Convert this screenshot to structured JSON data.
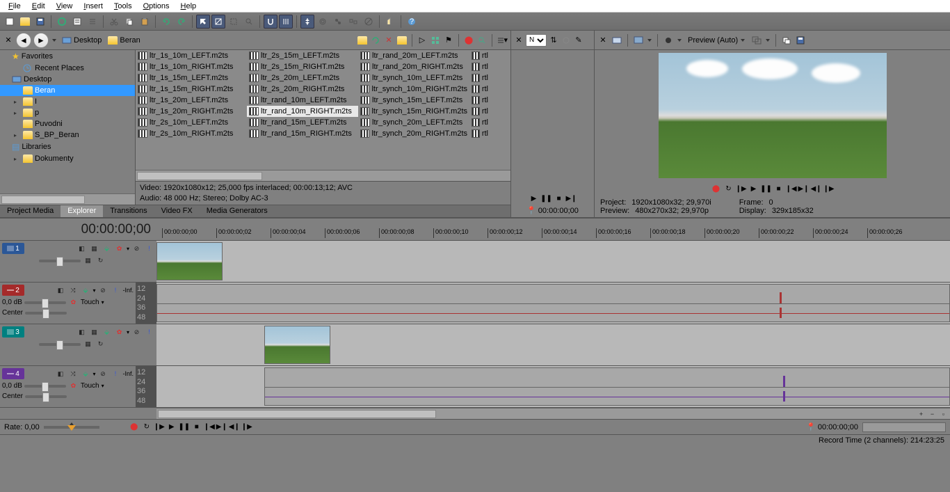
{
  "menu": [
    "File",
    "Edit",
    "View",
    "Insert",
    "Tools",
    "Options",
    "Help"
  ],
  "breadcrumb": {
    "root": "Desktop",
    "current": "Beran"
  },
  "tree": [
    {
      "type": "fav",
      "label": "Favorites",
      "depth": 0,
      "icon": "star"
    },
    {
      "type": "fav",
      "label": "Recent Places",
      "depth": 1,
      "icon": "recent"
    },
    {
      "type": "node",
      "label": "Desktop",
      "depth": 0,
      "icon": "desktop"
    },
    {
      "type": "folder",
      "label": "Beran",
      "depth": 1,
      "selected": true
    },
    {
      "type": "folder",
      "label": "I",
      "depth": 1,
      "expander": true
    },
    {
      "type": "folder",
      "label": "p",
      "depth": 1,
      "expander": true
    },
    {
      "type": "folder",
      "label": "Puvodni",
      "depth": 1
    },
    {
      "type": "folder",
      "label": "S_BP_Beran",
      "depth": 1,
      "expander": true
    },
    {
      "type": "lib",
      "label": "Libraries",
      "depth": 0,
      "icon": "lib"
    },
    {
      "type": "folder",
      "label": "Dokumenty",
      "depth": 1,
      "expander": true
    }
  ],
  "files": {
    "cols": [
      [
        "ltr_1s_10m_LEFT.m2ts",
        "ltr_1s_10m_RIGHT.m2ts",
        "ltr_1s_15m_LEFT.m2ts",
        "ltr_1s_15m_RIGHT.m2ts",
        "ltr_1s_20m_LEFT.m2ts",
        "ltr_1s_20m_RIGHT.m2ts",
        "ltr_2s_10m_LEFT.m2ts",
        "ltr_2s_10m_RIGHT.m2ts"
      ],
      [
        "ltr_2s_15m_LEFT.m2ts",
        "ltr_2s_15m_RIGHT.m2ts",
        "ltr_2s_20m_LEFT.m2ts",
        "ltr_2s_20m_RIGHT.m2ts",
        "ltr_rand_10m_LEFT.m2ts",
        "ltr_rand_10m_RIGHT.m2ts",
        "ltr_rand_15m_LEFT.m2ts",
        "ltr_rand_15m_RIGHT.m2ts"
      ],
      [
        "ltr_rand_20m_LEFT.m2ts",
        "ltr_rand_20m_RIGHT.m2ts",
        "ltr_synch_10m_LEFT.m2ts",
        "ltr_synch_10m_RIGHT.m2ts",
        "ltr_synch_15m_LEFT.m2ts",
        "ltr_synch_15m_RIGHT.m2ts",
        "ltr_synch_20m_LEFT.m2ts",
        "ltr_synch_20m_RIGHT.m2ts"
      ],
      [
        "rtl",
        "rtl",
        "rtl",
        "rtl",
        "rtl",
        "rtl",
        "rtl",
        "rtl"
      ]
    ],
    "selected": "ltr_rand_10m_RIGHT.m2ts",
    "status_line1": "Video: 1920x1080x12; 25,000 fps interlaced; 00:00:13;12; AVC",
    "status_line2": "Audio: 48 000 Hz; Stereo; Dolby AC-3"
  },
  "tabs": [
    "Project Media",
    "Explorer",
    "Transitions",
    "Video FX",
    "Media Generators"
  ],
  "active_tab": "Explorer",
  "trimmer": {
    "dropdown": "N",
    "timecode": "00:00:00;00"
  },
  "preview": {
    "quality": "Preview (Auto)",
    "project_label": "Project:",
    "project_val": "1920x1080x32; 29,970i",
    "preview_label": "Preview:",
    "preview_val": "480x270x32; 29,970p",
    "frame_label": "Frame:",
    "frame_val": "0",
    "display_label": "Display:",
    "display_val": "329x185x32"
  },
  "timecode": "00:00:00;00",
  "ruler_ticks": [
    "00:00:00;00",
    "00:00:00;02",
    "00:00:00;04",
    "00:00:00;06",
    "00:00:00;08",
    "00:00:00;10",
    "00:00:00;12",
    "00:00:00;14",
    "00:00:00;16",
    "00:00:00;18",
    "00:00:00;20",
    "00:00:00;22",
    "00:00:00;24",
    "00:00:00;26"
  ],
  "tracks": [
    {
      "num": "1",
      "color": "tn-blue",
      "type": "video"
    },
    {
      "num": "2",
      "color": "tn-red",
      "type": "audio",
      "vol": "0,0 dB",
      "pan": "Center",
      "mode": "Touch",
      "inf": "-Inf.",
      "meters": [
        "12",
        "24",
        "36",
        "48"
      ]
    },
    {
      "num": "3",
      "color": "tn-teal",
      "type": "video"
    },
    {
      "num": "4",
      "color": "tn-purple",
      "type": "audio",
      "vol": "0,0 dB",
      "pan": "Center",
      "mode": "Touch",
      "inf": "-Inf.",
      "meters": [
        "12",
        "24",
        "36",
        "48"
      ]
    }
  ],
  "rate": {
    "label": "Rate:",
    "value": "0,00"
  },
  "bottom_timecode": "00:00:00;00",
  "status": "Record Time (2 channels): 214:23:25"
}
